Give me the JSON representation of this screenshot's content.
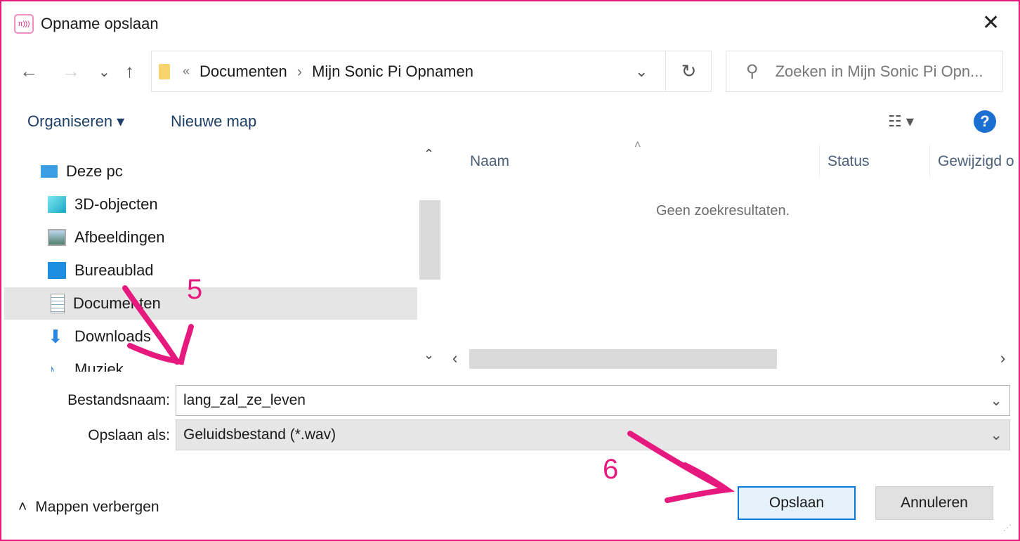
{
  "window": {
    "title": "Opname opslaan",
    "app_icon": "sonic-pi-icon",
    "close": "✕"
  },
  "nav": {
    "back": "←",
    "forward": "→",
    "recent": "⌄",
    "up": "↑"
  },
  "address": {
    "overflow": "«",
    "crumbs": [
      "Documenten",
      "Mijn Sonic Pi Opnamen"
    ],
    "sep": "›",
    "dropdown": "⌄",
    "refresh": "↻"
  },
  "search": {
    "placeholder": "Zoeken in Mijn Sonic Pi Opn..."
  },
  "toolbar": {
    "organize": "Organiseren ▾",
    "new_folder": "Nieuwe map",
    "view": "☷ ▾",
    "help": "?"
  },
  "sidebar": {
    "items": [
      {
        "label": "Deze pc",
        "icon": "computer-icon"
      },
      {
        "label": "3D-objecten",
        "icon": "cube-icon"
      },
      {
        "label": "Afbeeldingen",
        "icon": "pictures-icon"
      },
      {
        "label": "Bureaublad",
        "icon": "desktop-icon"
      },
      {
        "label": "Documenten",
        "icon": "documents-icon",
        "selected": true
      },
      {
        "label": "Downloads",
        "icon": "download-icon"
      },
      {
        "label": "Muziek",
        "icon": "music-icon"
      }
    ]
  },
  "content": {
    "columns": [
      "Naam",
      "Status",
      "Gewijzigd o"
    ],
    "empty": "Geen zoekresultaten."
  },
  "form": {
    "filename_label": "Bestandsnaam:",
    "filename_value": "lang_zal_ze_leven",
    "type_label": "Opslaan als:",
    "type_value": "Geluidsbestand (*.wav)"
  },
  "footer": {
    "hide_folders": "Mappen verbergen",
    "save": "Opslaan",
    "cancel": "Annuleren"
  },
  "annotations": {
    "step5": "5",
    "step6": "6",
    "color": "#e6197e"
  }
}
